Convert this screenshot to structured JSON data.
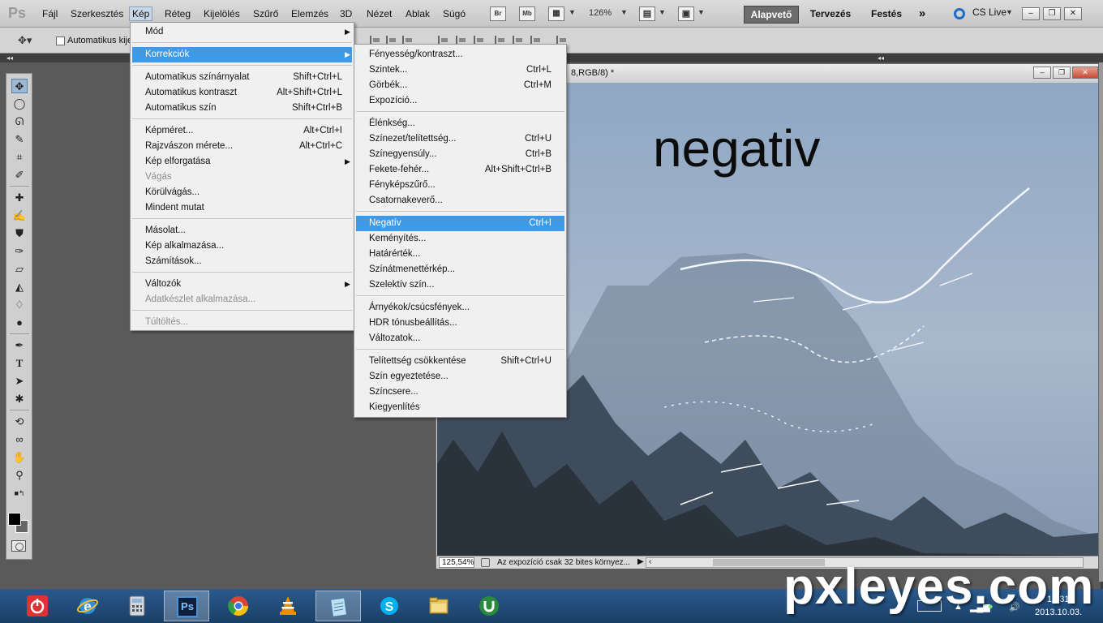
{
  "app": {
    "logo": "Ps",
    "menus": [
      "Fájl",
      "Szerkesztés",
      "Kép",
      "Réteg",
      "Kijelölés",
      "Szűrő",
      "Elemzés",
      "3D",
      "Nézet",
      "Ablak",
      "Súgó"
    ],
    "active_menu": "Kép",
    "bridge_btn": "Br",
    "minibridge_btn": "Mb",
    "zoom_level": "126%",
    "workspaces": [
      "Alapvető",
      "Tervezés",
      "Festés"
    ],
    "active_workspace": "Alapvető",
    "more_workspaces": "»",
    "cs_live": "CS Live",
    "window_buttons": [
      "–",
      "❐",
      "✕"
    ]
  },
  "options_bar": {
    "auto_select_label": "Automatikus kije"
  },
  "document": {
    "title_suffix": "8,RGB/8) *",
    "canvas_text": "negativ",
    "zoom_field": "125,54%",
    "status_text": "Az expozíció csak 32 bites környez...",
    "buttons": [
      "–",
      "❐",
      "✕"
    ]
  },
  "image_menu": {
    "items": [
      {
        "label": "Mód",
        "shortcut": "",
        "submenu": true,
        "disabled": false
      },
      {
        "label": "Korrekciók",
        "shortcut": "",
        "submenu": true,
        "disabled": false,
        "highlighted": true
      },
      {
        "label": "Automatikus színárnyalat",
        "shortcut": "Shift+Ctrl+L"
      },
      {
        "label": "Automatikus kontraszt",
        "shortcut": "Alt+Shift+Ctrl+L"
      },
      {
        "label": "Automatikus szín",
        "shortcut": "Shift+Ctrl+B"
      },
      {
        "label": "Képméret...",
        "shortcut": "Alt+Ctrl+I"
      },
      {
        "label": "Rajzvászon mérete...",
        "shortcut": "Alt+Ctrl+C"
      },
      {
        "label": "Kép elforgatása",
        "shortcut": "",
        "submenu": true
      },
      {
        "label": "Vágás",
        "shortcut": "",
        "disabled": true
      },
      {
        "label": "Körülvágás...",
        "shortcut": ""
      },
      {
        "label": "Mindent mutat",
        "shortcut": ""
      },
      {
        "label": "Másolat...",
        "shortcut": ""
      },
      {
        "label": "Kép alkalmazása...",
        "shortcut": ""
      },
      {
        "label": "Számítások...",
        "shortcut": ""
      },
      {
        "label": "Változók",
        "shortcut": "",
        "submenu": true
      },
      {
        "label": "Adatkészlet alkalmazása...",
        "shortcut": "",
        "disabled": true
      },
      {
        "label": "Túltöltés...",
        "shortcut": "",
        "disabled": true
      }
    ]
  },
  "adjustments_menu": {
    "items": [
      {
        "label": "Fényesség/kontraszt...",
        "shortcut": ""
      },
      {
        "label": "Szintek...",
        "shortcut": "Ctrl+L"
      },
      {
        "label": "Görbék...",
        "shortcut": "Ctrl+M"
      },
      {
        "label": "Expozíció...",
        "shortcut": ""
      },
      {
        "label": "Élénkség...",
        "shortcut": ""
      },
      {
        "label": "Színezet/telítettség...",
        "shortcut": "Ctrl+U"
      },
      {
        "label": "Színegyensúly...",
        "shortcut": "Ctrl+B"
      },
      {
        "label": "Fekete-fehér...",
        "shortcut": "Alt+Shift+Ctrl+B"
      },
      {
        "label": "Fényképszűrő...",
        "shortcut": ""
      },
      {
        "label": "Csatornakeverő...",
        "shortcut": ""
      },
      {
        "label": "Negatív",
        "shortcut": "Ctrl+I",
        "highlighted": true
      },
      {
        "label": "Keményítés...",
        "shortcut": ""
      },
      {
        "label": "Határérték...",
        "shortcut": ""
      },
      {
        "label": "Színátmenettérkép...",
        "shortcut": ""
      },
      {
        "label": "Szelektív szín...",
        "shortcut": ""
      },
      {
        "label": "Árnyékok/csúcsfények...",
        "shortcut": ""
      },
      {
        "label": "HDR tónusbeállítás...",
        "shortcut": ""
      },
      {
        "label": "Változatok...",
        "shortcut": ""
      },
      {
        "label": "Telítettség csökkentése",
        "shortcut": "Shift+Ctrl+U"
      },
      {
        "label": "Szín egyeztetése...",
        "shortcut": ""
      },
      {
        "label": "Színcsere...",
        "shortcut": ""
      },
      {
        "label": "Kiegyenlítés",
        "shortcut": ""
      }
    ]
  },
  "taskbar": {
    "apps": [
      "power-app",
      "internet-explorer",
      "calculator",
      "photoshop",
      "chrome",
      "vlc",
      "notepad",
      "skype",
      "file-explorer",
      "utorrent"
    ],
    "active_app": "photoshop",
    "ps_label": "Ps",
    "clock_time": "18:31",
    "clock_date": "2013.10.03."
  },
  "watermark": "pxleyes.com",
  "colors": {
    "menu_highlight": "#3d9ae8",
    "workspace_active": "#6c6c6c",
    "taskbar": "#1a3f66",
    "foreground_color": "#000000",
    "background_color": "#666666"
  }
}
